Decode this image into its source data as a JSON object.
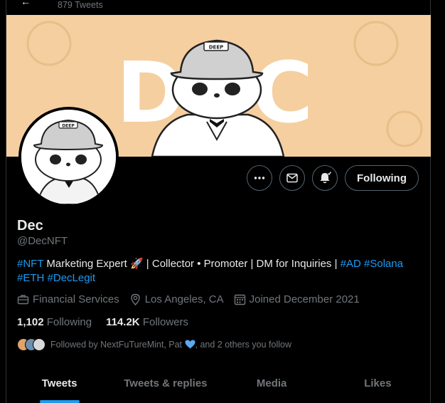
{
  "header": {
    "tweet_count": "879 Tweets"
  },
  "profile": {
    "name": "Dec",
    "handle": "@DecNFT",
    "banner_text": "DEC",
    "hat_text": "DEEP"
  },
  "actions": {
    "follow_label": "Following"
  },
  "bio": {
    "tag_nft": "#NFT",
    "text_1": " Marketing Expert 🚀 | Collector • Promoter | DM for Inquiries | ",
    "tag_ad": "#AD",
    "tag_solana": "#Solana",
    "tag_eth": "#ETH",
    "tag_declegit": "#DecLegit"
  },
  "meta": {
    "category": "Financial Services",
    "location": "Los Angeles, CA",
    "joined": "Joined December 2021"
  },
  "stats": {
    "following_count": "1,102",
    "following_label": "Following",
    "followers_count": "114.2K",
    "followers_label": "Followers"
  },
  "followed_by": {
    "text_1": "Followed by NextFuTureMint, Pat",
    "text_2": ", and 2 others you follow"
  },
  "tabs": [
    {
      "label": "Tweets"
    },
    {
      "label": "Tweets & replies"
    },
    {
      "label": "Media"
    },
    {
      "label": "Likes"
    }
  ],
  "colors": {
    "accent": "#1d9bf0",
    "banner": "#f5cfa0",
    "background": "#000000"
  },
  "icons": [
    "more-icon",
    "message-icon",
    "notification-bell-icon",
    "briefcase-icon",
    "location-icon",
    "calendar-icon",
    "blue-heart-icon"
  ]
}
